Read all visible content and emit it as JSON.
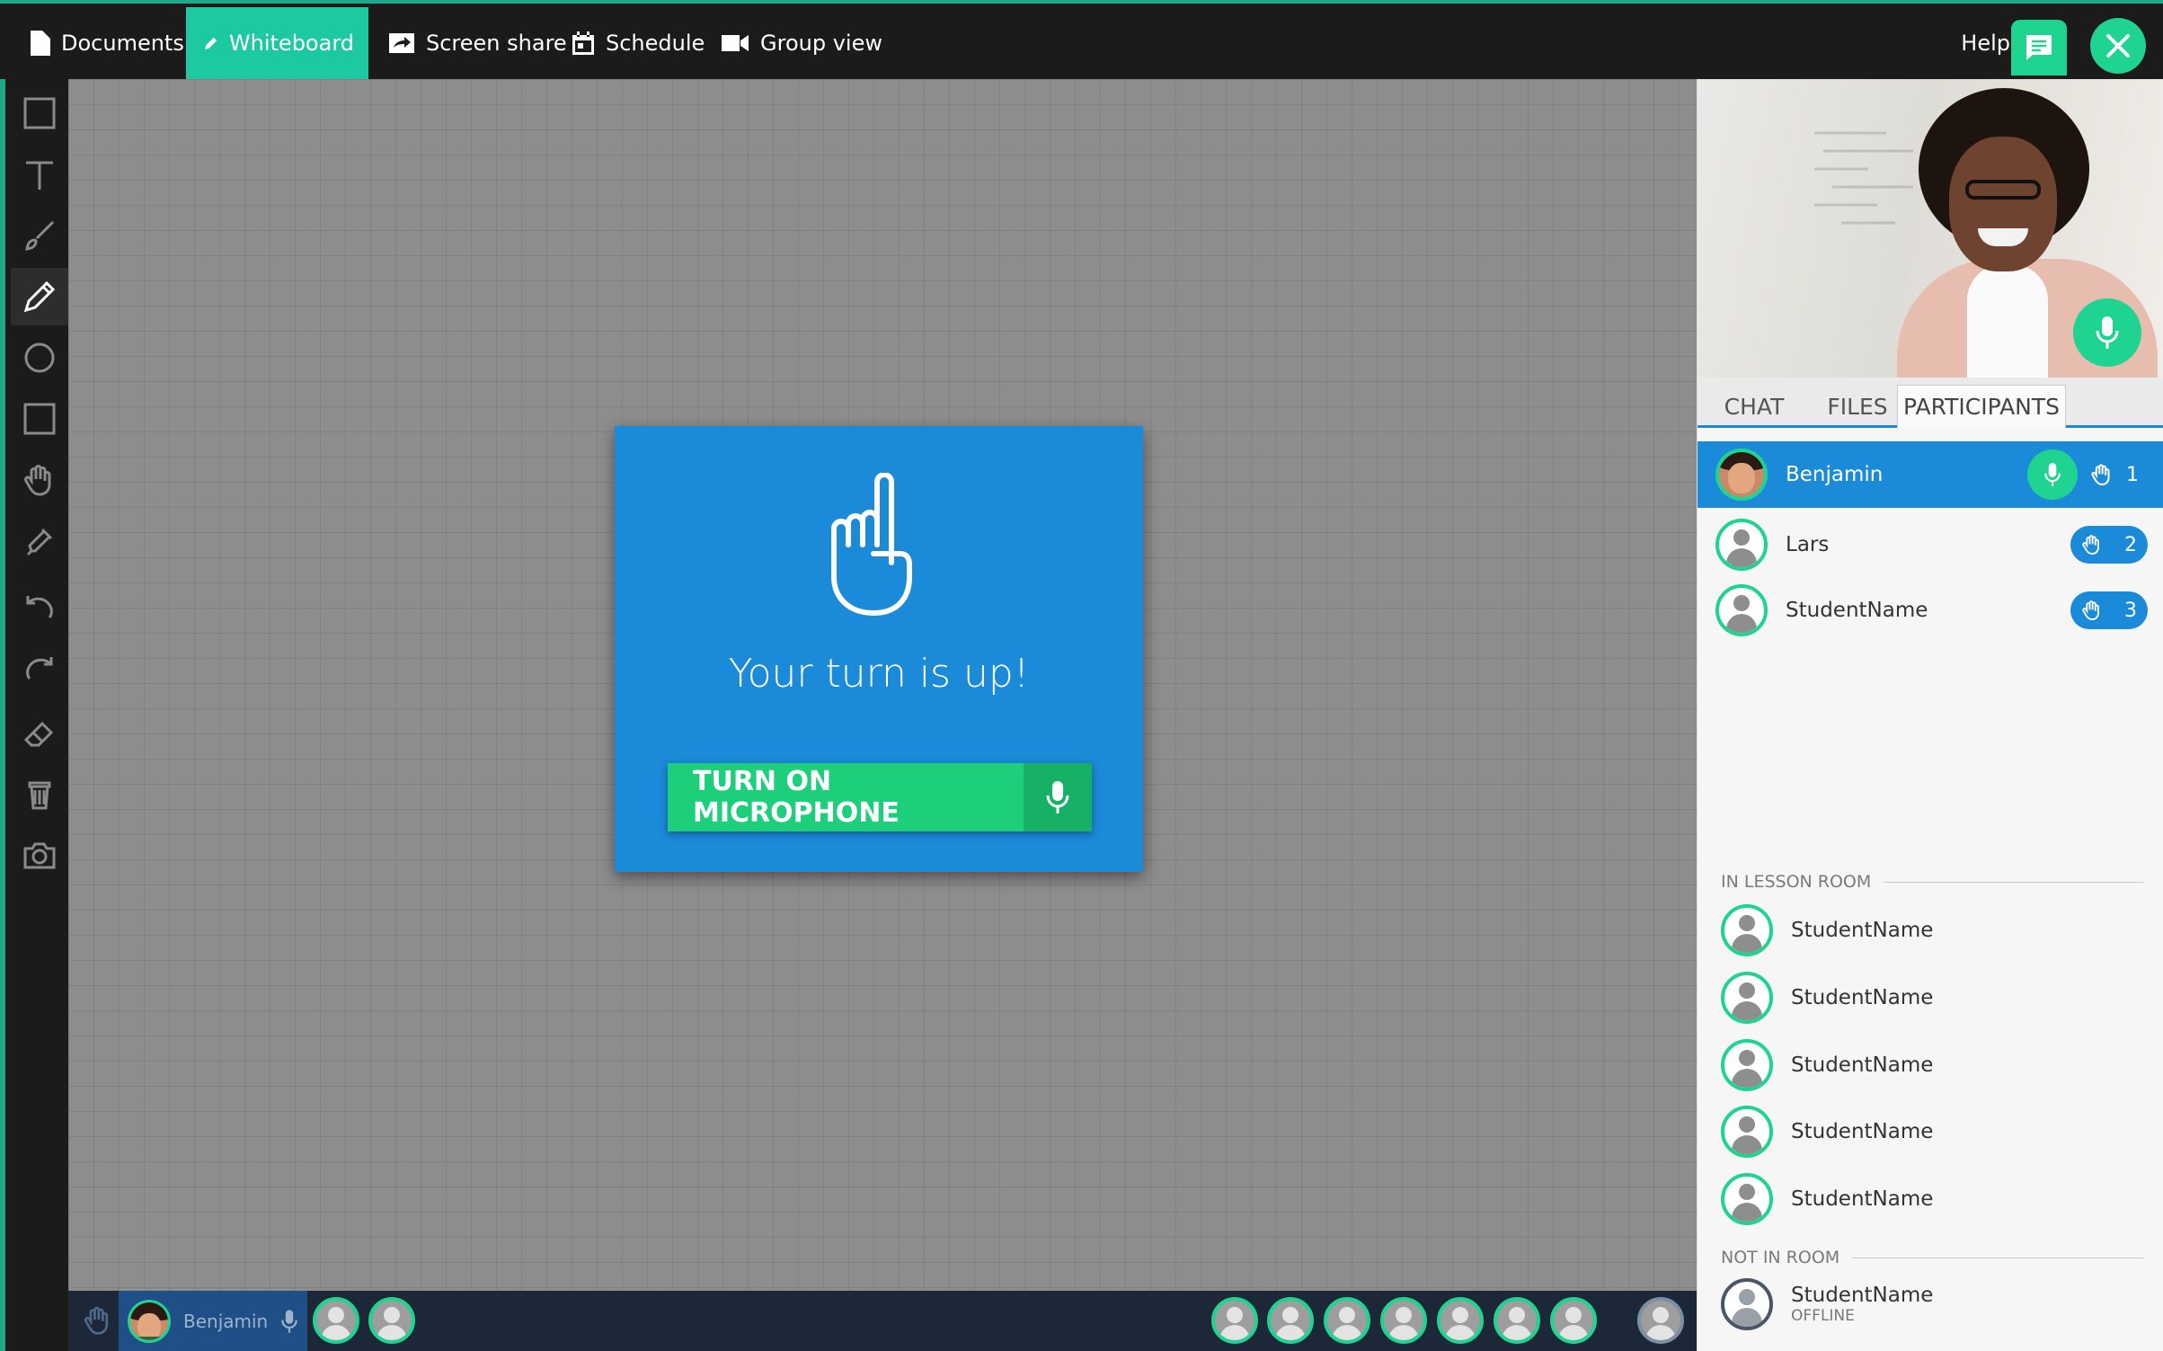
{
  "nav": {
    "items": [
      {
        "label": "Documents",
        "icon": "document-icon"
      },
      {
        "label": "Whiteboard",
        "icon": "pencil-icon"
      },
      {
        "label": "Screen share",
        "icon": "screen-share-icon"
      },
      {
        "label": "Schedule",
        "icon": "calendar-icon"
      },
      {
        "label": "Group view",
        "icon": "video-camera-icon"
      }
    ],
    "active": "Whiteboard",
    "help": "Help"
  },
  "colors": {
    "accent": "#1dc9a0",
    "green": "#1ed490",
    "blue": "#1a8ad9",
    "dark": "#1b1b1b"
  },
  "toolbar": {
    "tools": [
      "select",
      "text",
      "brush",
      "pencil",
      "circle",
      "rectangle",
      "hand",
      "marker",
      "undo",
      "redo",
      "eraser",
      "trash",
      "camera"
    ],
    "active": "pencil"
  },
  "modal": {
    "title": "Your turn is up!",
    "button_label": "TURN ON MICROPHONE"
  },
  "bottombar": {
    "self_name": "Benjamin"
  },
  "panel": {
    "tabs": [
      "CHAT",
      "FILES",
      "PARTICIPANTS"
    ],
    "active_tab": "PARTICIPANTS",
    "queue": [
      {
        "name": "Benjamin",
        "position": "1"
      },
      {
        "name": "Lars",
        "position": "2"
      },
      {
        "name": "StudentName",
        "position": "3"
      }
    ],
    "in_room_label": "IN LESSON ROOM",
    "in_room": [
      "StudentName",
      "StudentName",
      "StudentName",
      "StudentName",
      "StudentName"
    ],
    "not_in_room_label": "NOT IN ROOM",
    "not_in_room": [
      {
        "name": "StudentName",
        "status": "OFFLINE"
      }
    ]
  }
}
